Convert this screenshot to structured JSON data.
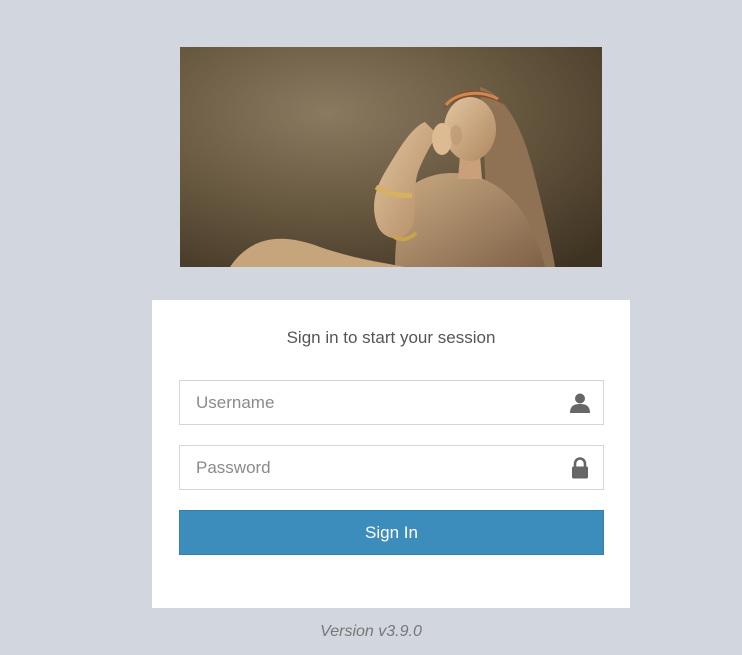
{
  "logo": {
    "alt": "Terracotta statue of a reclining woman"
  },
  "login": {
    "message": "Sign in to start your session",
    "username": {
      "placeholder": "Username",
      "value": "",
      "icon": "user-icon"
    },
    "password": {
      "placeholder": "Password",
      "value": "",
      "icon": "lock-icon"
    },
    "submit_label": "Sign In"
  },
  "footer": {
    "version": "Version v3.9.0"
  },
  "colors": {
    "page_background": "#d2d6de",
    "button_primary": "#3c8dbc",
    "box_background": "#ffffff"
  }
}
